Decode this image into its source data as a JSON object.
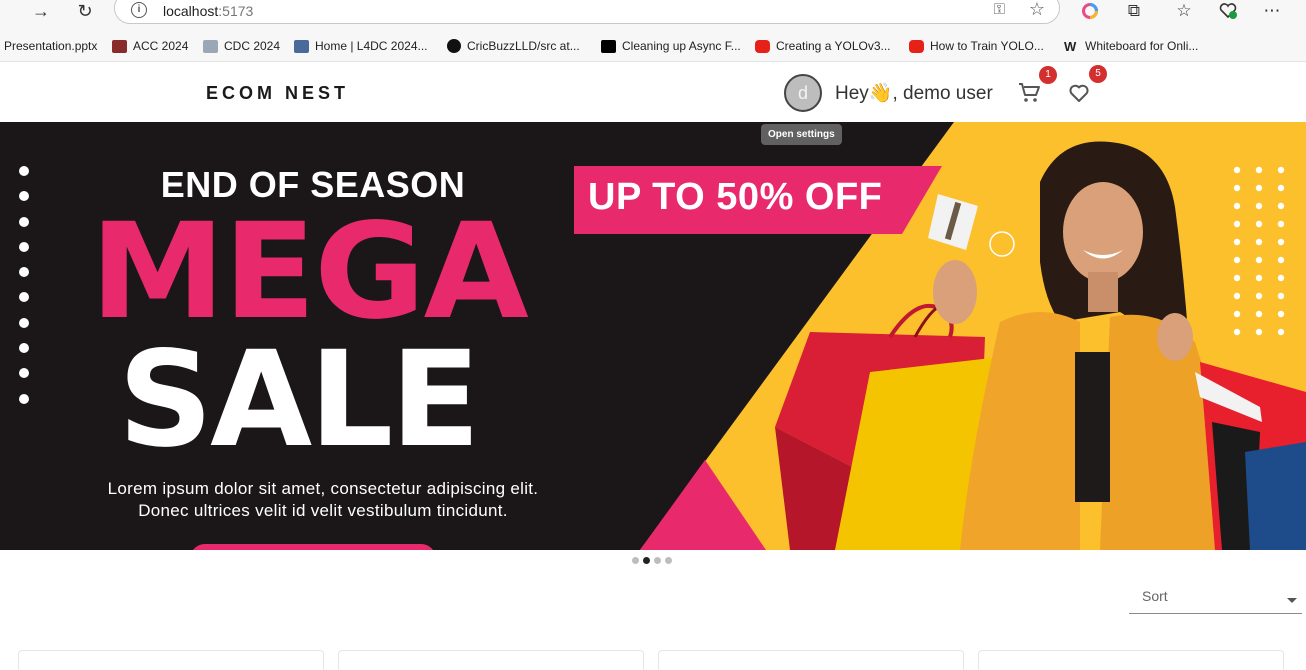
{
  "browser": {
    "url_host": "localhost",
    "url_port": ":5173",
    "bookmarks": [
      {
        "label": "Presentation.pptx",
        "icon": "document-icon",
        "color": "#f7f7f7"
      },
      {
        "label": "ACC 2024",
        "icon": "acc-icon",
        "color": "#8a2b2b"
      },
      {
        "label": "CDC 2024",
        "icon": "cdc-icon",
        "color": "#7a8a9a"
      },
      {
        "label": "Home | L4DC 2024...",
        "icon": "l4dc-icon",
        "color": "#4a6a9a"
      },
      {
        "label": "CricBuzzLLD/src at...",
        "icon": "github-icon",
        "color": "#111111"
      },
      {
        "label": "Cleaning up Async F...",
        "icon": "dev-icon",
        "color": "#000000"
      },
      {
        "label": "Creating a YOLOv3...",
        "icon": "youtube-icon",
        "color": "#e62117"
      },
      {
        "label": "How to Train YOLO...",
        "icon": "youtube-icon",
        "color": "#e62117"
      },
      {
        "label": "Whiteboard for Onli...",
        "icon": "whiteboard-icon",
        "color": "#222222"
      }
    ]
  },
  "header": {
    "logo": "ECOM NEST",
    "avatar_initial": "d",
    "greeting": "Hey👋, demo user",
    "cart_count": "1",
    "wishlist_count": "5",
    "tooltip": "Open settings"
  },
  "hero": {
    "heading": "END OF SEASON",
    "mega": "MEGA",
    "sale": "SALE",
    "promo": "UP TO 50% OFF",
    "body_line1": "Lorem ipsum dolor sit amet, consectetur adipiscing elit.",
    "body_line2": "Donec ultrices velit id velit vestibulum tincidunt.",
    "colors": {
      "dark": "#1b1718",
      "pink": "#e8296b",
      "yellow": "#fcc02c"
    }
  },
  "carousel": {
    "count": 4,
    "active": 1
  },
  "sort": {
    "label": "Sort"
  }
}
